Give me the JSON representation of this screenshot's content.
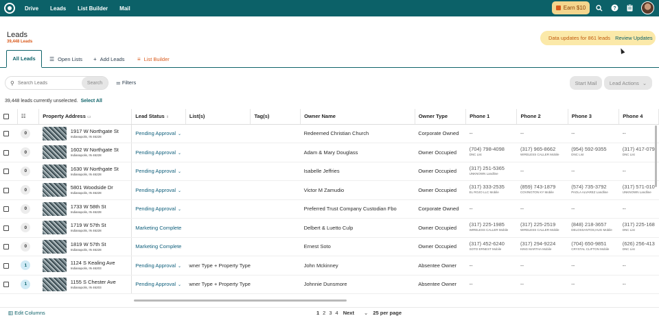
{
  "nav": {
    "items": [
      "Drive",
      "Leads",
      "List Builder",
      "Mail"
    ],
    "earn": "Earn $10"
  },
  "header": {
    "title": "Leads",
    "count": "39,448 Leads"
  },
  "banner": {
    "text": "Data updates for 861 leads",
    "action": "Review Updates"
  },
  "tabs": [
    {
      "label": "All Leads",
      "icon": ""
    },
    {
      "label": "Open Lists",
      "icon": "list-icon"
    },
    {
      "label": "Add Leads",
      "icon": "plus-icon"
    },
    {
      "label": "List Builder",
      "icon": "list-builder-icon"
    }
  ],
  "toolbar": {
    "search_placeholder": "Search Leads",
    "search_button": "Search",
    "filters": "Filters",
    "start_mail": "Start Mail",
    "lead_actions": "Lead Actions"
  },
  "selection": {
    "info": "39,448 leads currently unselected.",
    "select_all": "Select All"
  },
  "columns": [
    "Property Address",
    "Lead Status",
    "List(s)",
    "Tag(s)",
    "Owner Name",
    "Owner Type",
    "Phone 1",
    "Phone 2",
    "Phone 3",
    "Phone 4"
  ],
  "rows": [
    {
      "count": "0",
      "a1": "1917 W Northgate St",
      "a2": "Indianapolis, IN 46228",
      "status": "Pending Approval",
      "lists": "",
      "owner": "Redeemed Christian Church",
      "type": "Corporate Owned",
      "p1": "--",
      "p1s": "",
      "p2": "--",
      "p2s": "",
      "p3": "--",
      "p3s": "",
      "p4": "--",
      "p4s": ""
    },
    {
      "count": "0",
      "a1": "1602 W Northgate St",
      "a2": "Indianapolis, IN 46228",
      "status": "Pending Approval",
      "lists": "",
      "owner": "Adam & Mary Douglass",
      "type": "Owner Occupied",
      "p1": "(704) 798-4098",
      "p1s": "DNC List",
      "p2": "(317) 965-8662",
      "p2s": "WIRELESS CALLER  Mobile",
      "p3": "(954) 592-9355",
      "p3s": "DNC List",
      "p4": "(317) 417-079",
      "p4s": "DNC List"
    },
    {
      "count": "0",
      "a1": "1630 W Northgate St",
      "a2": "Indianapolis, IN 46228",
      "status": "Pending Approval",
      "lists": "",
      "owner": "Isabelle Jeffries",
      "type": "Owner Occupied",
      "p1": "(317) 251-5365",
      "p1s": "UNKNOWN  Landline",
      "p2": "--",
      "p2s": "",
      "p3": "--",
      "p3s": "",
      "p4": "--",
      "p4s": ""
    },
    {
      "count": "0",
      "a1": "5801 Woodside Dr",
      "a2": "Indianapolis, IN 46228",
      "status": "Pending Approval",
      "lists": "",
      "owner": "Victor M Zamudio",
      "type": "Owner Occupied",
      "p1": "(317) 333-2535",
      "p1s": "EL ROJO LLC  Mobile",
      "p2": "(859) 743-1879",
      "p2s": "COVINGTON KY  Mobile",
      "p3": "(574) 735-3792",
      "p3s": "PAOLA ALVAREZ  Landline",
      "p4": "(317) 571-010",
      "p4s": "UNKNOWN  Landline"
    },
    {
      "count": "0",
      "a1": "1733 W 58th St",
      "a2": "Indianapolis, IN 46228",
      "status": "Pending Approval",
      "lists": "",
      "owner": "Preferred Trust Company Custodian Fbo",
      "type": "Corporate Owned",
      "p1": "--",
      "p1s": "",
      "p2": "--",
      "p2s": "",
      "p3": "--",
      "p3s": "",
      "p4": "--",
      "p4s": ""
    },
    {
      "count": "0",
      "a1": "1719 W 57th St",
      "a2": "Indianapolis, IN 46228",
      "status": "Marketing Complete",
      "lists": "",
      "owner": "Delbert & Luetto Culp",
      "type": "Owner Occupied",
      "p1": "(317) 225-1985",
      "p1s": "WIRELESS CALLER  Mobile",
      "p2": "(317) 225-2519",
      "p2s": "WIRELESS CALLER  Mobile",
      "p3": "(848) 218-3657",
      "p3s": "DELOSSANTOS,HUG  Mobile",
      "p4": "(317) 225-168",
      "p4s": "DNC List"
    },
    {
      "count": "0",
      "a1": "1819 W 57th St",
      "a2": "Indianapolis, IN 46228",
      "status": "Marketing Complete",
      "lists": "",
      "owner": "Ernest Soto",
      "type": "Owner Occupied",
      "p1": "(317) 452-6240",
      "p1s": "SOTO ERNEST  Mobile",
      "p2": "(317) 294-9224",
      "p2s": "KING MARTHA  Mobile",
      "p3": "(704) 650-9851",
      "p3s": "CRYSTAL CLIFTON  Mobile",
      "p4": "(626) 256-413",
      "p4s": "DNC List"
    },
    {
      "count": "1",
      "a1": "1124 S Kealing Ave",
      "a2": "Indianapolis, IN 46203",
      "status": "Pending Approval",
      "lists": "wner Type + Property Type",
      "owner": "John Mckinney",
      "type": "Absentee Owner",
      "p1": "--",
      "p1s": "",
      "p2": "--",
      "p2s": "",
      "p3": "--",
      "p3s": "",
      "p4": "--",
      "p4s": ""
    },
    {
      "count": "1",
      "a1": "1155 S Chester Ave",
      "a2": "Indianapolis, IN 46203",
      "status": "Pending Approval",
      "lists": "wner Type + Property Type",
      "owner": "Johnnie Dunsmore",
      "type": "Absentee Owner",
      "p1": "--",
      "p1s": "",
      "p2": "--",
      "p2s": "",
      "p3": "--",
      "p3s": "",
      "p4": "--",
      "p4s": ""
    }
  ],
  "footer": {
    "edit_columns": "Edit Columns",
    "pages": [
      "1",
      "2",
      "3",
      "4"
    ],
    "next": "Next",
    "per_page": "25 per page"
  },
  "colors": {
    "brand": "#0c6168",
    "accent": "#d9591a",
    "banner": "#fbe9a9",
    "earn": "#f4d58d"
  }
}
